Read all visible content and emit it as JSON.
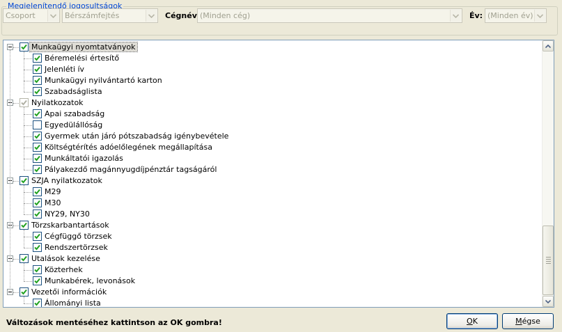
{
  "filters": {
    "group_title": "Megjelenítendő jogosultságok",
    "group_select": "Csoport",
    "function_select": "Bérszámfejtés",
    "company_label": "Cégnév:",
    "company_select": "(Minden cég)",
    "year_label": "Év:",
    "year_select": "(Minden év)"
  },
  "tree": {
    "items": [
      {
        "label": "Munkaügyi nyomtatványok",
        "level": 0,
        "state": "checked",
        "selected": true
      },
      {
        "label": "Béremelési értesítő",
        "level": 1,
        "state": "checked"
      },
      {
        "label": "Jelenléti ív",
        "level": 1,
        "state": "checked"
      },
      {
        "label": "Munkaügyi nyilvántartó karton",
        "level": 1,
        "state": "checked"
      },
      {
        "label": "Szabadságlista",
        "level": 1,
        "state": "checked"
      },
      {
        "label": "Nyilatkozatok",
        "level": 0,
        "state": "grayed"
      },
      {
        "label": "Apai szabadság",
        "level": 1,
        "state": "checked"
      },
      {
        "label": "Egyedülállóság",
        "level": 1,
        "state": "unchecked"
      },
      {
        "label": "Gyermek után járó pótszabadság igénybevétele",
        "level": 1,
        "state": "checked"
      },
      {
        "label": "Költségtérítés adóelőlegének megállapítása",
        "level": 1,
        "state": "checked"
      },
      {
        "label": "Munkáltatói igazolás",
        "level": 1,
        "state": "checked"
      },
      {
        "label": "Pályakezdő magánnyugdíjpénztár tagságáról",
        "level": 1,
        "state": "checked"
      },
      {
        "label": "SZJA nyilatkozatok",
        "level": 0,
        "state": "checked"
      },
      {
        "label": "M29",
        "level": 1,
        "state": "checked"
      },
      {
        "label": "M30",
        "level": 1,
        "state": "checked"
      },
      {
        "label": "NY29, NY30",
        "level": 1,
        "state": "checked"
      },
      {
        "label": "Törzskarbantartások",
        "level": 0,
        "state": "checked"
      },
      {
        "label": "Cégfüggő törzsek",
        "level": 1,
        "state": "checked"
      },
      {
        "label": "Rendszertörzsek",
        "level": 1,
        "state": "checked"
      },
      {
        "label": "Utalások kezelése",
        "level": 0,
        "state": "checked"
      },
      {
        "label": "Közterhek",
        "level": 1,
        "state": "checked"
      },
      {
        "label": "Munkabérek, levonások",
        "level": 1,
        "state": "checked"
      },
      {
        "label": "Vezetői információk",
        "level": 0,
        "state": "checked"
      },
      {
        "label": "Állományi lista",
        "level": 1,
        "state": "checked"
      }
    ]
  },
  "footer": {
    "message": "Változások mentéséhez kattintson az OK gombra!",
    "ok_mnemonic": "O",
    "ok_rest": "K",
    "cancel_mnemonic": "M",
    "cancel_rest": "égse"
  },
  "colors": {
    "group_title": "#0046d5",
    "checkbox_border": "#1c5180",
    "check_mark": "#21a121"
  }
}
